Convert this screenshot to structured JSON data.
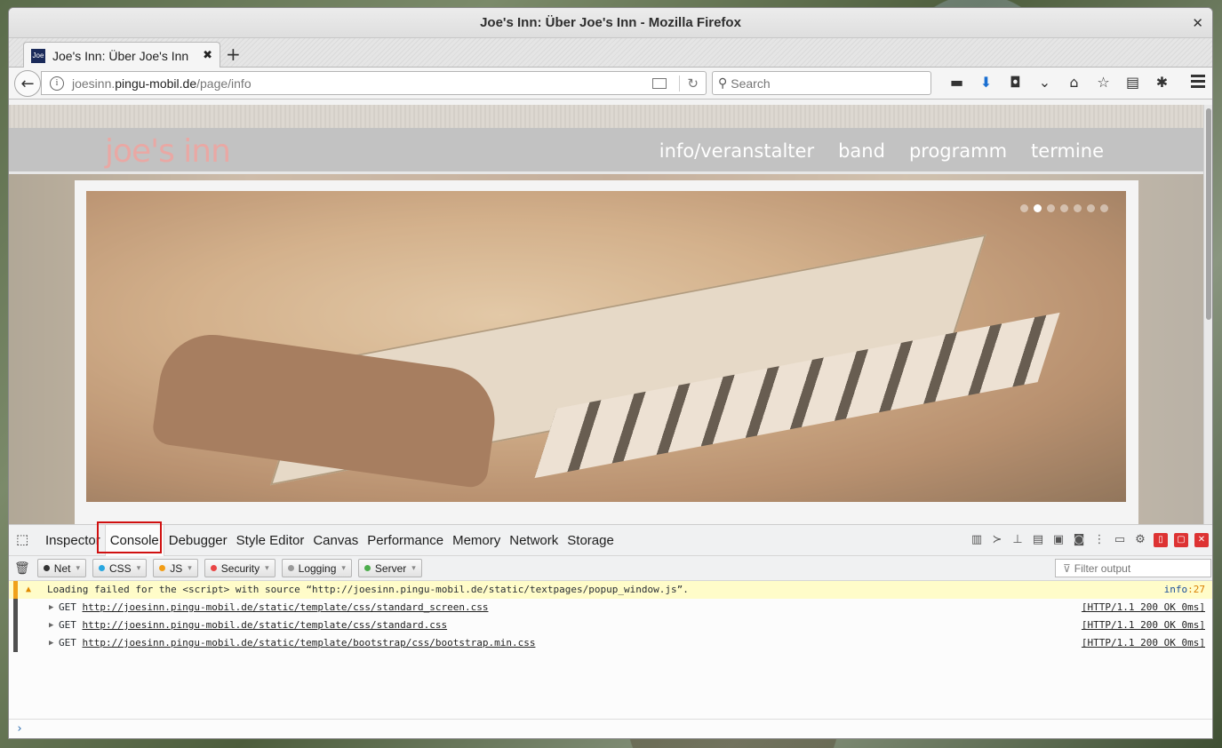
{
  "window": {
    "title": "Joe's Inn: Über Joe's Inn - Mozilla Firefox",
    "close_icon": "✕"
  },
  "tab": {
    "favicon_text": "Joe",
    "label": "Joe's Inn: Über Joe's Inn",
    "close": "✖",
    "new_tab": "+"
  },
  "urlbar": {
    "host_prefix": "joesinn.",
    "host_domain": "pingu-mobil.de",
    "path": "/page/info"
  },
  "search": {
    "placeholder": "Search"
  },
  "page": {
    "logo": "joe's inn",
    "nav": [
      "info/veranstalter",
      "band",
      "programm",
      "termine"
    ],
    "slider_dots": 7,
    "active_dot": 1
  },
  "devtools": {
    "tabs": [
      "Inspector",
      "Console",
      "Debugger",
      "Style Editor",
      "Canvas",
      "Performance",
      "Memory",
      "Network",
      "Storage"
    ],
    "active_tab": "Console",
    "filters": [
      {
        "label": "Net",
        "color": "#333333"
      },
      {
        "label": "CSS",
        "color": "#2aa7e0"
      },
      {
        "label": "JS",
        "color": "#f29d16"
      },
      {
        "label": "Security",
        "color": "#e94545"
      },
      {
        "label": "Logging",
        "color": "#9a9a9a"
      },
      {
        "label": "Server",
        "color": "#4cad4c"
      }
    ],
    "filter_placeholder": "Filter output",
    "warning": {
      "text": "Loading failed for the <script> with source “http://joesinn.pingu-mobil.de/static/textpages/popup_window.js”.",
      "source_file": "info",
      "source_line": ":27"
    },
    "requests": [
      {
        "method": "GET",
        "url": "http://joesinn.pingu-mobil.de/static/template/css/standard_screen.css",
        "status": "[HTTP/1.1 200 OK 0ms]"
      },
      {
        "method": "GET",
        "url": "http://joesinn.pingu-mobil.de/static/template/css/standard.css",
        "status": "[HTTP/1.1 200 OK 0ms]"
      },
      {
        "method": "GET",
        "url": "http://joesinn.pingu-mobil.de/static/template/bootstrap/css/bootstrap.min.css",
        "status": "[HTTP/1.1 200 OK 0ms]"
      }
    ],
    "prompt": "›"
  }
}
